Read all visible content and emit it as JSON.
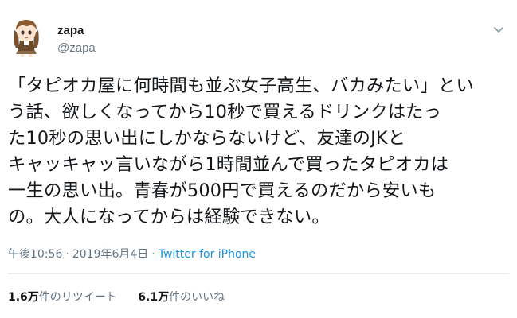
{
  "user": {
    "display_name": "zapa",
    "handle": "@zapa"
  },
  "tweet": {
    "lines": [
      "「タピオカ屋に何時間も並ぶ女子高生、バカみたい」とい",
      "う話、欲しくなってから10秒で買えるドリンクはたっ",
      "た10秒の思い出にしかならないけど、友達のJKと",
      "キャッキャッ言いながら1時間並んで買ったタピオカは",
      "一生の思い出。青春が500円で買えるのだから安いも",
      "の。大人になってからは経験できない。"
    ],
    "time": "午後10:56",
    "separator": "·",
    "date": "2019年6月4日",
    "source": "Twitter for iPhone"
  },
  "stats": {
    "retweets_count": "1.6万",
    "retweets_label": "件のリツイート",
    "likes_count": "6.1万",
    "likes_label": "件のいいね"
  },
  "icons": {
    "avatar": "anime-girl-avatar",
    "caret": "chevron-down-icon"
  },
  "colors": {
    "text": "#14171a",
    "secondary": "#657786",
    "link": "#1b95e0",
    "divider": "#e6ecf0"
  }
}
